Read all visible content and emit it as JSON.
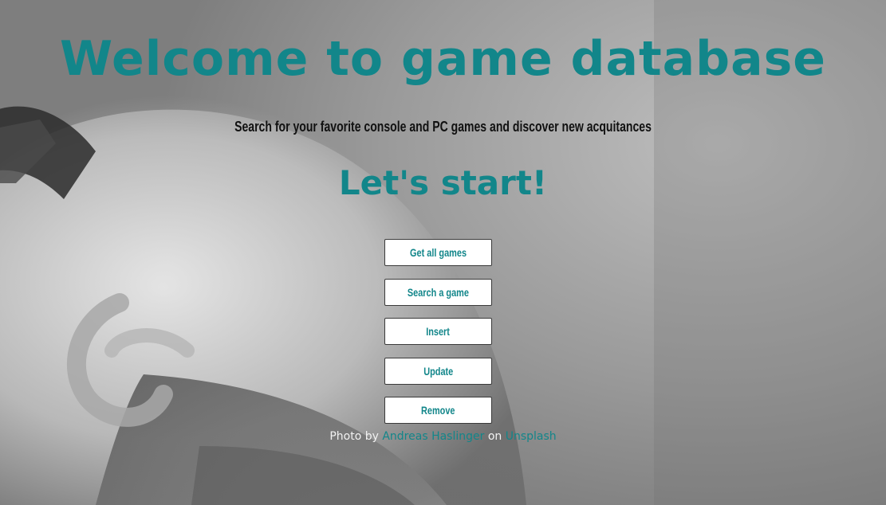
{
  "header": {
    "title": "Welcome to game database",
    "subtitle": "Search for your favorite console and PC games and discover new acquitances",
    "start": "Let's start!"
  },
  "actions": [
    {
      "label": "Get all games"
    },
    {
      "label": "Search a game"
    },
    {
      "label": "Insert"
    },
    {
      "label": "Update"
    },
    {
      "label": "Remove"
    }
  ],
  "credit": {
    "prefix": "Photo by",
    "author": "Andreas Haslinger",
    "middle": "on",
    "source": "Unsplash"
  },
  "colors": {
    "accent": "#12868a",
    "subtitle": "#111111",
    "button_bg": "#ffffff"
  }
}
